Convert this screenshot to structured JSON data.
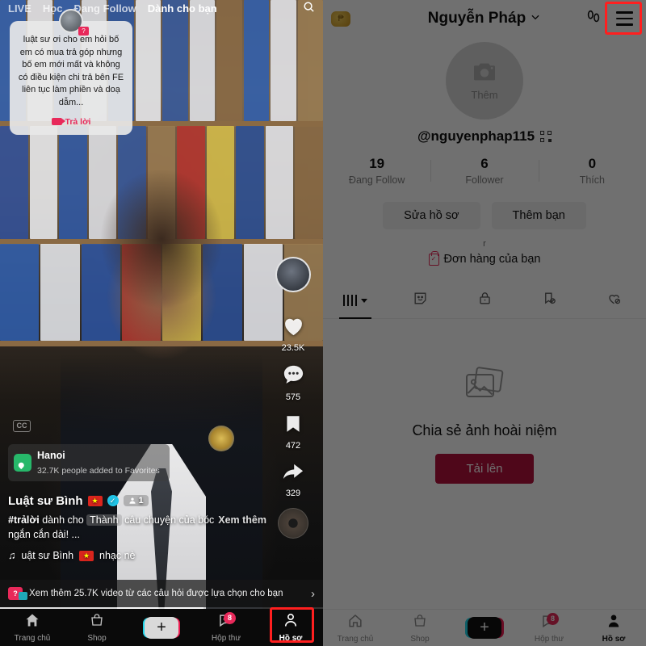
{
  "feed": {
    "top_tabs": [
      {
        "label": "LIVE",
        "active": false
      },
      {
        "label": "Học",
        "active": false
      },
      {
        "label": "Đang Follow",
        "active": false
      },
      {
        "label": "Dành cho bạn",
        "active": true
      }
    ],
    "search_icon": "search-icon",
    "comment_card": {
      "text": "luật sư ơi cho em hỏi bố em có mua trả góp nhưng bố em mới mất và không có điều kiện chi trả bên FE liên tục làm phiền và doạ dẫm...",
      "reply_label": "Trả lời",
      "reply_icon": "video-camera-icon"
    },
    "cc_badge": "CC",
    "location": {
      "name": "Hanoi",
      "subtitle": "32.7K people added to Favorites",
      "icon": "location-pin-icon"
    },
    "caption": {
      "author": "Luật sư Bình",
      "flag": "🇻🇳",
      "verified_icon": "verified-badge-icon",
      "tag_count": "1",
      "hashtag": "#trảlời",
      "text_before": " dành cho ",
      "mention": "Thành",
      "text_after": " câu chuyện của bóc ngắn cắn dài! ...",
      "more_label": "Xem thêm",
      "music_icon": "music-note-icon",
      "music_text": "uật sư Bình",
      "music_suffix": "nhạc nè"
    },
    "rail": [
      {
        "name": "like",
        "icon": "heart-icon",
        "count": "23.5K"
      },
      {
        "name": "comment",
        "icon": "comment-icon",
        "count": "575"
      },
      {
        "name": "favorite",
        "icon": "bookmark-icon",
        "count": "472"
      },
      {
        "name": "share",
        "icon": "share-arrow-icon",
        "count": "329"
      }
    ],
    "banner": {
      "text": "Xem thêm 25.7K video từ các câu hỏi được lựa chọn cho bạn",
      "chevron": "chevron-right-icon"
    },
    "bottom_nav": [
      {
        "label": "Trang chủ",
        "icon": "home-icon",
        "active": false,
        "badge": null
      },
      {
        "label": "Shop",
        "icon": "shop-bag-icon",
        "active": false,
        "badge": null
      },
      {
        "label": "",
        "icon": "plus-icon",
        "active": false,
        "badge": null
      },
      {
        "label": "Hộp thư",
        "icon": "inbox-icon",
        "active": false,
        "badge": "8"
      },
      {
        "label": "Hồ sơ",
        "icon": "profile-person-icon",
        "active": true,
        "badge": null
      }
    ]
  },
  "profile": {
    "header": {
      "coin_icon": "coin-icon",
      "title": "Nguyễn Pháp",
      "title_chevron": "chevron-down-icon",
      "footprints_icon": "footprints-icon",
      "menu_icon": "hamburger-menu-icon"
    },
    "avatar": {
      "camera_icon": "camera-icon",
      "add_label": "Thêm"
    },
    "handle": "@nguyenphap115",
    "qr_icon": "qr-code-icon",
    "stats": [
      {
        "value": "19",
        "label": "Đang Follow"
      },
      {
        "value": "6",
        "label": "Follower"
      },
      {
        "value": "0",
        "label": "Thích"
      }
    ],
    "actions": [
      {
        "label": "Sửa hồ sơ"
      },
      {
        "label": "Thêm bạn"
      }
    ],
    "bio": "r",
    "orders": {
      "icon": "shopping-bag-check-icon",
      "label": "Đơn hàng của bạn"
    },
    "tabs": [
      {
        "icon": "grid-icon",
        "active": true,
        "has_caret": true
      },
      {
        "icon": "sticker-smiley-icon",
        "active": false,
        "has_caret": false
      },
      {
        "icon": "lock-icon",
        "active": false,
        "has_caret": false
      },
      {
        "icon": "bookmark-hidden-icon",
        "active": false,
        "has_caret": false
      },
      {
        "icon": "heart-hidden-icon",
        "active": false,
        "has_caret": false
      }
    ],
    "empty_state": {
      "icon": "photo-stack-icon",
      "title": "Chia sẻ ảnh hoài niệm",
      "button_label": "Tải lên"
    },
    "bottom_nav": [
      {
        "label": "Trang chủ",
        "icon": "home-icon",
        "active": false,
        "badge": null
      },
      {
        "label": "Shop",
        "icon": "shop-bag-icon",
        "active": false,
        "badge": null
      },
      {
        "label": "",
        "icon": "plus-icon",
        "active": false,
        "badge": null
      },
      {
        "label": "Hộp thư",
        "icon": "inbox-icon",
        "active": false,
        "badge": "8"
      },
      {
        "label": "Hồ sơ",
        "icon": "profile-person-icon",
        "active": true,
        "badge": null
      }
    ]
  },
  "colors": {
    "accent_red": "#e8295a",
    "upload_red": "#b3123c",
    "highlight_box": "#ff1f1f",
    "coin_gold": "#d9a42a"
  }
}
